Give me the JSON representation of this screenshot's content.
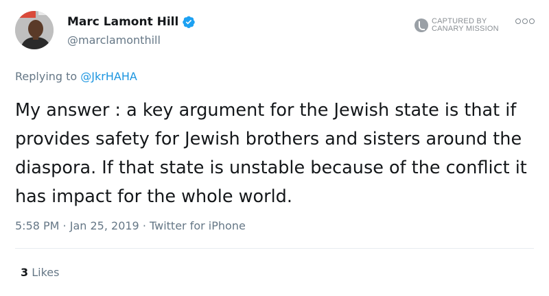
{
  "author": {
    "display_name": "Marc Lamont Hill",
    "handle": "@marclamonthill",
    "verified": true,
    "avatar_icon": "profile-photo"
  },
  "watermark": {
    "icon": "canary-mission-logo",
    "line1": "CAPTURED BY",
    "line2": "CANARY MISSION"
  },
  "menu_icon": "more-options-icon",
  "reply": {
    "prefix": "Replying to ",
    "mention": "@JkrHAHA"
  },
  "tweet_text": "My answer : a key argument for the Jewish state is that if provides safety for Jewish brothers and sisters around the diaspora. If that state is unstable because of the conflict it has impact for the whole world.",
  "meta": {
    "time": "5:58 PM",
    "date": "Jan 25, 2019",
    "source": "Twitter for iPhone",
    "separator": " · "
  },
  "stats": {
    "likes_count": "3",
    "likes_label": " Likes"
  },
  "colors": {
    "text": "#14171a",
    "secondary": "#657786",
    "link": "#1b95e0",
    "verified": "#1da1f2"
  }
}
